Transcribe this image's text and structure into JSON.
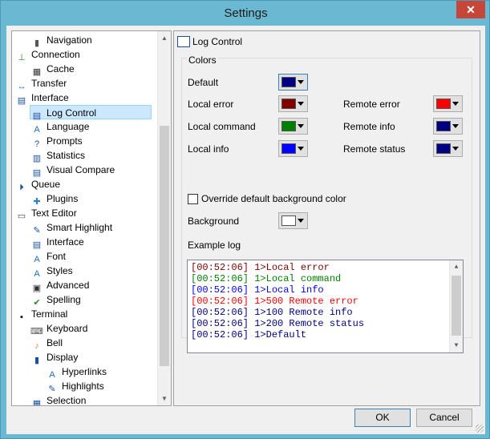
{
  "window": {
    "title": "Settings",
    "close_glyph": "✕"
  },
  "tree": {
    "items": [
      {
        "label": "Navigation",
        "icon": "mouse-icon",
        "indent": 1
      },
      {
        "label": "Connection",
        "icon": "connection-icon",
        "indent": 0
      },
      {
        "label": "Cache",
        "icon": "cache-icon",
        "indent": 1
      },
      {
        "label": "Transfer",
        "icon": "transfer-icon",
        "indent": 0
      },
      {
        "label": "Interface",
        "icon": "interface-icon",
        "indent": 0
      },
      {
        "label": "Log Control",
        "icon": "log-control-icon",
        "indent": 1,
        "selected": true
      },
      {
        "label": "Language",
        "icon": "language-icon",
        "indent": 1
      },
      {
        "label": "Prompts",
        "icon": "prompts-icon",
        "indent": 1
      },
      {
        "label": "Statistics",
        "icon": "statistics-icon",
        "indent": 1
      },
      {
        "label": "Visual Compare",
        "icon": "visual-compare-icon",
        "indent": 1
      },
      {
        "label": "Queue",
        "icon": "queue-icon",
        "indent": 0
      },
      {
        "label": "Plugins",
        "icon": "plugins-icon",
        "indent": 1
      },
      {
        "label": "Text Editor",
        "icon": "text-editor-icon",
        "indent": 0
      },
      {
        "label": "Smart Highlight",
        "icon": "smart-highlight-icon",
        "indent": 1
      },
      {
        "label": "Interface",
        "icon": "interface-icon",
        "indent": 1
      },
      {
        "label": "Font",
        "icon": "font-icon",
        "indent": 1
      },
      {
        "label": "Styles",
        "icon": "styles-icon",
        "indent": 1
      },
      {
        "label": "Advanced",
        "icon": "advanced-icon",
        "indent": 1
      },
      {
        "label": "Spelling",
        "icon": "spelling-icon",
        "indent": 1
      },
      {
        "label": "Terminal",
        "icon": "terminal-icon",
        "indent": 0
      },
      {
        "label": "Keyboard",
        "icon": "keyboard-icon",
        "indent": 1
      },
      {
        "label": "Bell",
        "icon": "bell-icon",
        "indent": 1
      },
      {
        "label": "Display",
        "icon": "display-icon",
        "indent": 1
      },
      {
        "label": "Hyperlinks",
        "icon": "hyperlinks-icon",
        "indent": 2
      },
      {
        "label": "Highlights",
        "icon": "highlights-icon",
        "indent": 2
      },
      {
        "label": "Selection",
        "icon": "selection-icon",
        "indent": 1
      }
    ]
  },
  "panel": {
    "title": "Log Control",
    "colors_group": "Colors",
    "default_label": "Default",
    "local_error_label": "Local error",
    "remote_error_label": "Remote error",
    "local_command_label": "Local command",
    "remote_info_label": "Remote info",
    "local_info_label": "Local info",
    "remote_status_label": "Remote status",
    "override_label": "Override default background color",
    "override_checked": false,
    "background_label": "Background",
    "example_log_label": "Example log",
    "colors": {
      "default": "#000080",
      "local_error": "#800000",
      "remote_error": "#ff0000",
      "local_command": "#008000",
      "remote_info": "#000080",
      "local_info": "#0000ff",
      "remote_status": "#000080",
      "background": "#ffffff"
    }
  },
  "log": {
    "lines": [
      {
        "text": "[00:52:06] 1>Local error",
        "color": "#800000"
      },
      {
        "text": "[00:52:06] 1>Local command",
        "color": "#008000"
      },
      {
        "text": "[00:52:06] 1>Local info",
        "color": "#0000ff"
      },
      {
        "text": "[00:52:06] 1>500 Remote error",
        "color": "#ff0000"
      },
      {
        "text": "[00:52:06] 1>100 Remote info",
        "color": "#000080"
      },
      {
        "text": "[00:52:06] 1>200 Remote status",
        "color": "#000080"
      },
      {
        "text": "[00:52:06] 1>Default",
        "color": "#000080"
      }
    ]
  },
  "buttons": {
    "ok": "OK",
    "cancel": "Cancel"
  }
}
